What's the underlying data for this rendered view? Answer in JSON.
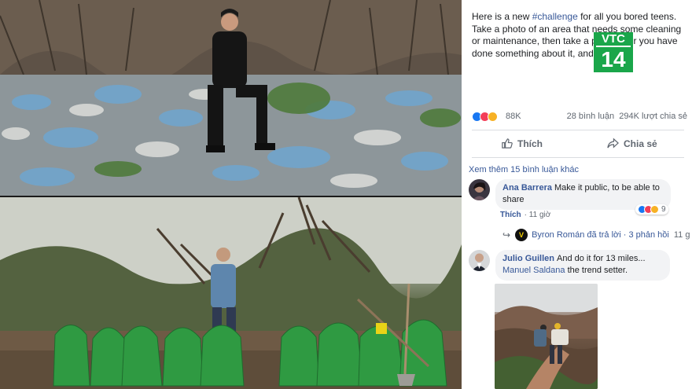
{
  "post": {
    "text_before": "Here is a new ",
    "hashtag": "#challenge",
    "text_after": " for all you bored teens. Take a photo of an area that needs some cleaning or maintenance, then take a photo after you have done something about it, and post it."
  },
  "watermark": {
    "line1": "VTC",
    "line2": "14",
    "color": "#1aa64a"
  },
  "stats": {
    "reaction_icons": [
      "like-icon",
      "love-icon",
      "wow-icon"
    ],
    "reaction_count": "88K",
    "comments": "28 bình luận",
    "shares": "294K lượt chia sẻ"
  },
  "actions": {
    "like_label": "Thích",
    "share_label": "Chia sẻ"
  },
  "more_comments": "Xem thêm 15 bình luận khác",
  "comments": [
    {
      "author": "Ana Barrera",
      "text": "Make it public, to be able to share",
      "like_label": "Thích",
      "time": "11 giờ",
      "reaction_count": "9"
    },
    {
      "author": "Julio Guillen",
      "text": "And do it for 13 miles...",
      "mention": "Manuel Saldana",
      "mention_text": " the trend setter."
    }
  ],
  "reply": {
    "author": "Byron Román",
    "action": "đã trả lời",
    "separator": "·",
    "count": "3 phản hồi",
    "time": "11 g"
  },
  "colors": {
    "link": "#385898",
    "like": "#1877f2",
    "love": "#f33e58",
    "wow": "#f7b125"
  }
}
